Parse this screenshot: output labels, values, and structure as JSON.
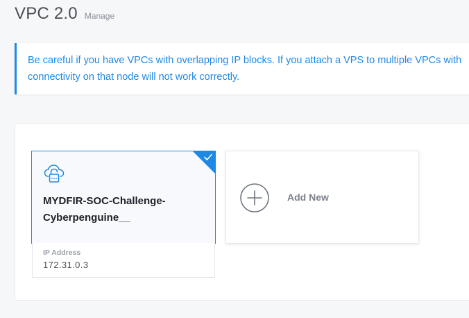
{
  "header": {
    "title": "VPC 2.0",
    "manage_label": "Manage"
  },
  "notice": {
    "line1": "Be careful if you have VPCs with overlapping IP blocks. If you attach a VPS to multiple VPCs with",
    "line2": "connectivity on that node will not work correctly."
  },
  "vpc_list": {
    "items": [
      {
        "name": "MYDFIR-SOC-Challenge-Cyberpenguine__",
        "ip_label": "IP Address",
        "ip_value": "172.31.0.3",
        "selected": true
      }
    ],
    "add_new_label": "Add New"
  },
  "colors": {
    "accent": "#1e88e5",
    "title": "#4a4f57",
    "muted": "#8a8f97"
  },
  "icons": {
    "vpc": "cloud-lock-icon",
    "selected": "checkmark-icon",
    "add": "plus-circle-icon"
  }
}
